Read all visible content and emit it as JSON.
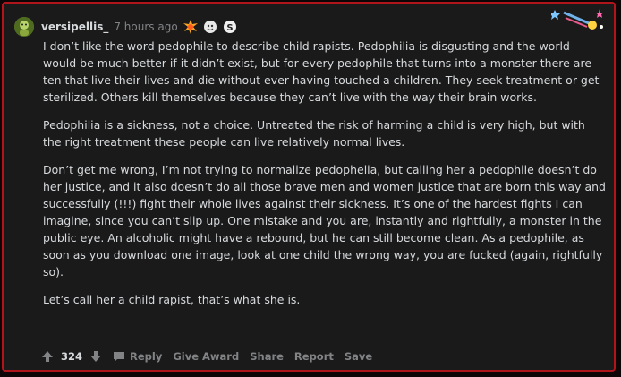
{
  "comment": {
    "username": "versipellis_",
    "timestamp": "7 hours ago",
    "paragraphs": [
      "I don’t like the word pedophile to describe child rapists. Pedophilia is disgusting and the world would be much better if it didn’t exist, but for every pedophile that turns into a monster there are ten that live their lives and die without ever having touched a children. They seek treatment or get sterilized. Others kill themselves because they can’t live with the way their brain works.",
      "Pedophilia is a sickness, not a choice. Untreated the risk of harming a child is very high, but with the right treatment these people can live relatively normal lives.",
      "Don’t get me wrong, I’m not trying to normalize pedophelia, but calling her a pedophile doesn’t do her justice, and it also doesn’t do all those brave men and women justice that are born this way and successfully (!!!) fight their whole lives against their sickness. It’s one of the hardest fights I can imagine, since you can’t slip up. One mistake and you are, instantly and rightfully, a monster in the public eye. An alcoholic might have a rebound, but he can still become clean. As a pedophile, as soon as you download one image, look at one child the wrong way, you are fucked (again, rightfully so).",
      "Let’s call her a child rapist, that’s what she is."
    ],
    "score": "324",
    "actions": {
      "reply": "Reply",
      "give_award": "Give Award",
      "share": "Share",
      "report": "Report",
      "save": "Save"
    }
  },
  "colors": {
    "border": "#b0151c",
    "background": "#1a1a1b",
    "text": "#d7dadc",
    "muted": "#818384"
  },
  "icons": [
    "avatar",
    "award-explosion-icon",
    "award-face-icon",
    "award-s-icon",
    "award-rocket-icon",
    "upvote-icon",
    "downvote-icon",
    "comment-icon"
  ]
}
